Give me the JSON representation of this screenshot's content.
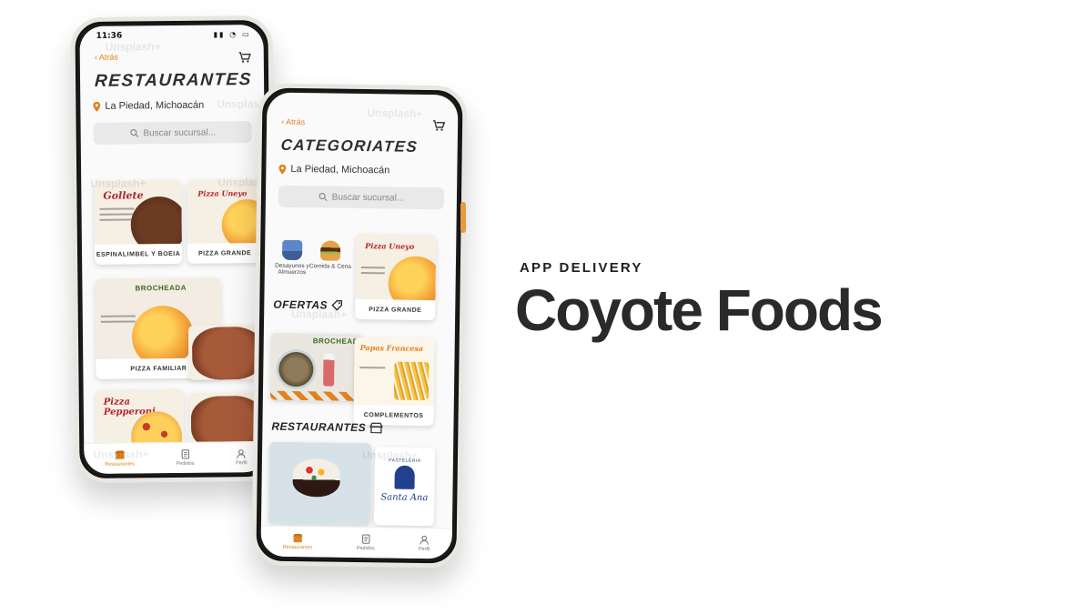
{
  "brand": {
    "kicker": "APP DELIVERY",
    "title": "Coyote Foods",
    "accent_color": "#e0821f"
  },
  "watermark_text": "Unsplash+",
  "back_phone": {
    "status_time": "11:36",
    "back_label": "Atrás",
    "heading": "RESTAURANTES",
    "location": "La Piedad, Michoacán",
    "search_placeholder": "Buscar sucursal...",
    "cards": [
      {
        "title": "Gollete",
        "caption": "ESPINALIMBEL Y BOEIA"
      },
      {
        "title": "Pizza Uneyo",
        "caption": "PIZZA GRANDE"
      },
      {
        "title": "BROCHEADA",
        "caption": "PIZZA FAMILIAR"
      },
      {
        "title": "Pizza Pepperoni",
        "caption": ""
      }
    ],
    "tabs": [
      {
        "label": "Restaurantes",
        "icon": "store-icon"
      },
      {
        "label": "Pedidos",
        "icon": "receipt-icon"
      },
      {
        "label": "Perfil",
        "icon": "user-icon"
      }
    ]
  },
  "front_phone": {
    "back_label": "Atrás",
    "heading": "CATEGORIATES",
    "location": "La Piedad, Michoacán",
    "search_placeholder": "Buscar sucursal...",
    "categories": [
      {
        "label": "Desayunos y Almuerzos",
        "icon": "coffee-cup-icon"
      },
      {
        "label": "Comida & Cena",
        "icon": "burger-icon"
      }
    ],
    "offers_heading": "OFERTAS",
    "restaurants_heading": "RESTAURANTES",
    "cards": [
      {
        "title": "Pizza Uneyo",
        "caption": "PIZZA GRANDE"
      },
      {
        "title": "BROCHEADA",
        "caption": ""
      },
      {
        "title": "Papas Francesa",
        "caption": "COMPLEMENTOS"
      }
    ],
    "restaurant_logo": {
      "name": "Santa Ana",
      "kicker": "PASTELERIA"
    },
    "tabs": [
      {
        "label": "Restaurantes",
        "icon": "store-icon"
      },
      {
        "label": "Pedidos",
        "icon": "receipt-icon"
      },
      {
        "label": "Perfil",
        "icon": "user-icon"
      }
    ]
  }
}
